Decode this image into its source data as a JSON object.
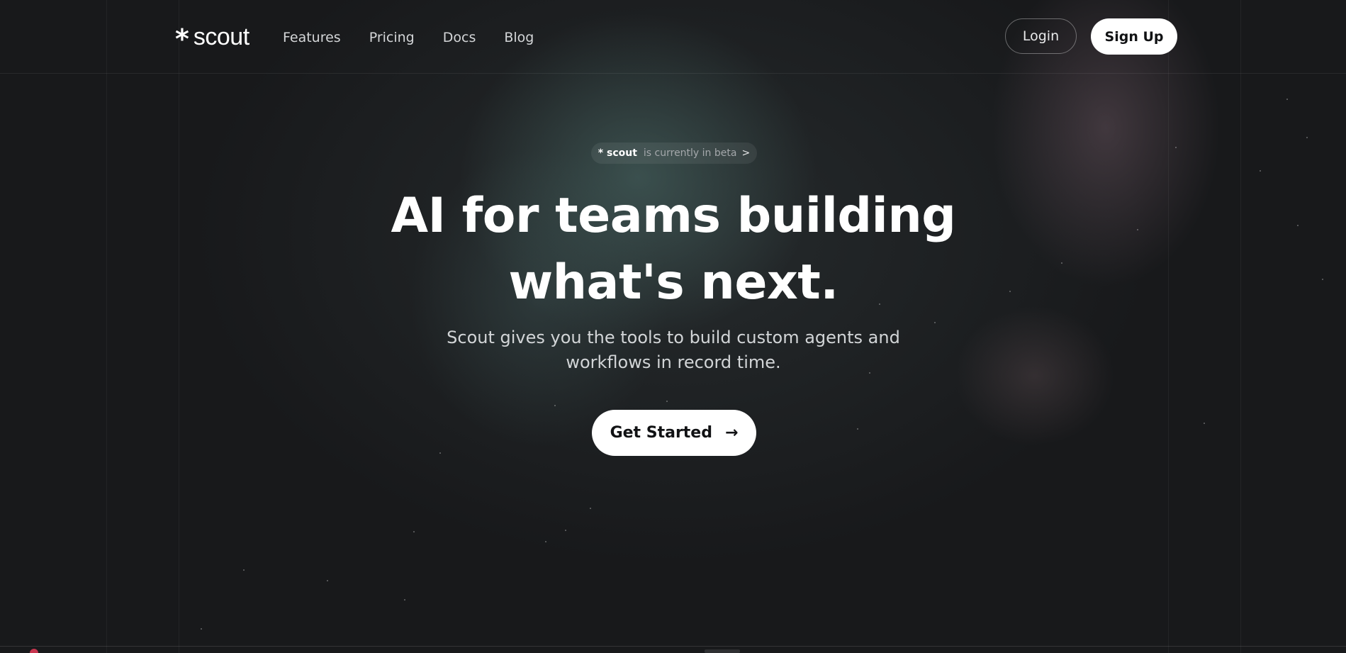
{
  "nav": {
    "logo_mark": "*",
    "logo_text": "scout",
    "links": [
      {
        "label": "Features"
      },
      {
        "label": "Pricing"
      },
      {
        "label": "Docs"
      },
      {
        "label": "Blog"
      }
    ],
    "login_label": "Login",
    "signup_label": "Sign Up"
  },
  "hero": {
    "beta_brand": "* scout",
    "beta_text": "is currently in beta",
    "beta_chevron": ">",
    "headline_line1": "AI for teams building",
    "headline_line2": "what's next.",
    "subtitle_line1": "Scout gives you the tools to build custom agents and",
    "subtitle_line2": "workflows in record time.",
    "cta_label": "Get Started",
    "cta_arrow": "→"
  },
  "icons": {
    "logo": "asterisk-icon",
    "cta": "arrow-right-icon",
    "beta": "chevron-right-icon"
  },
  "colors": {
    "background": "#18191b",
    "accent_teal": "#4a6a66",
    "accent_mauve": "#62505a",
    "primary_button": "#ffffff",
    "text_muted": "#a4a8ab"
  }
}
